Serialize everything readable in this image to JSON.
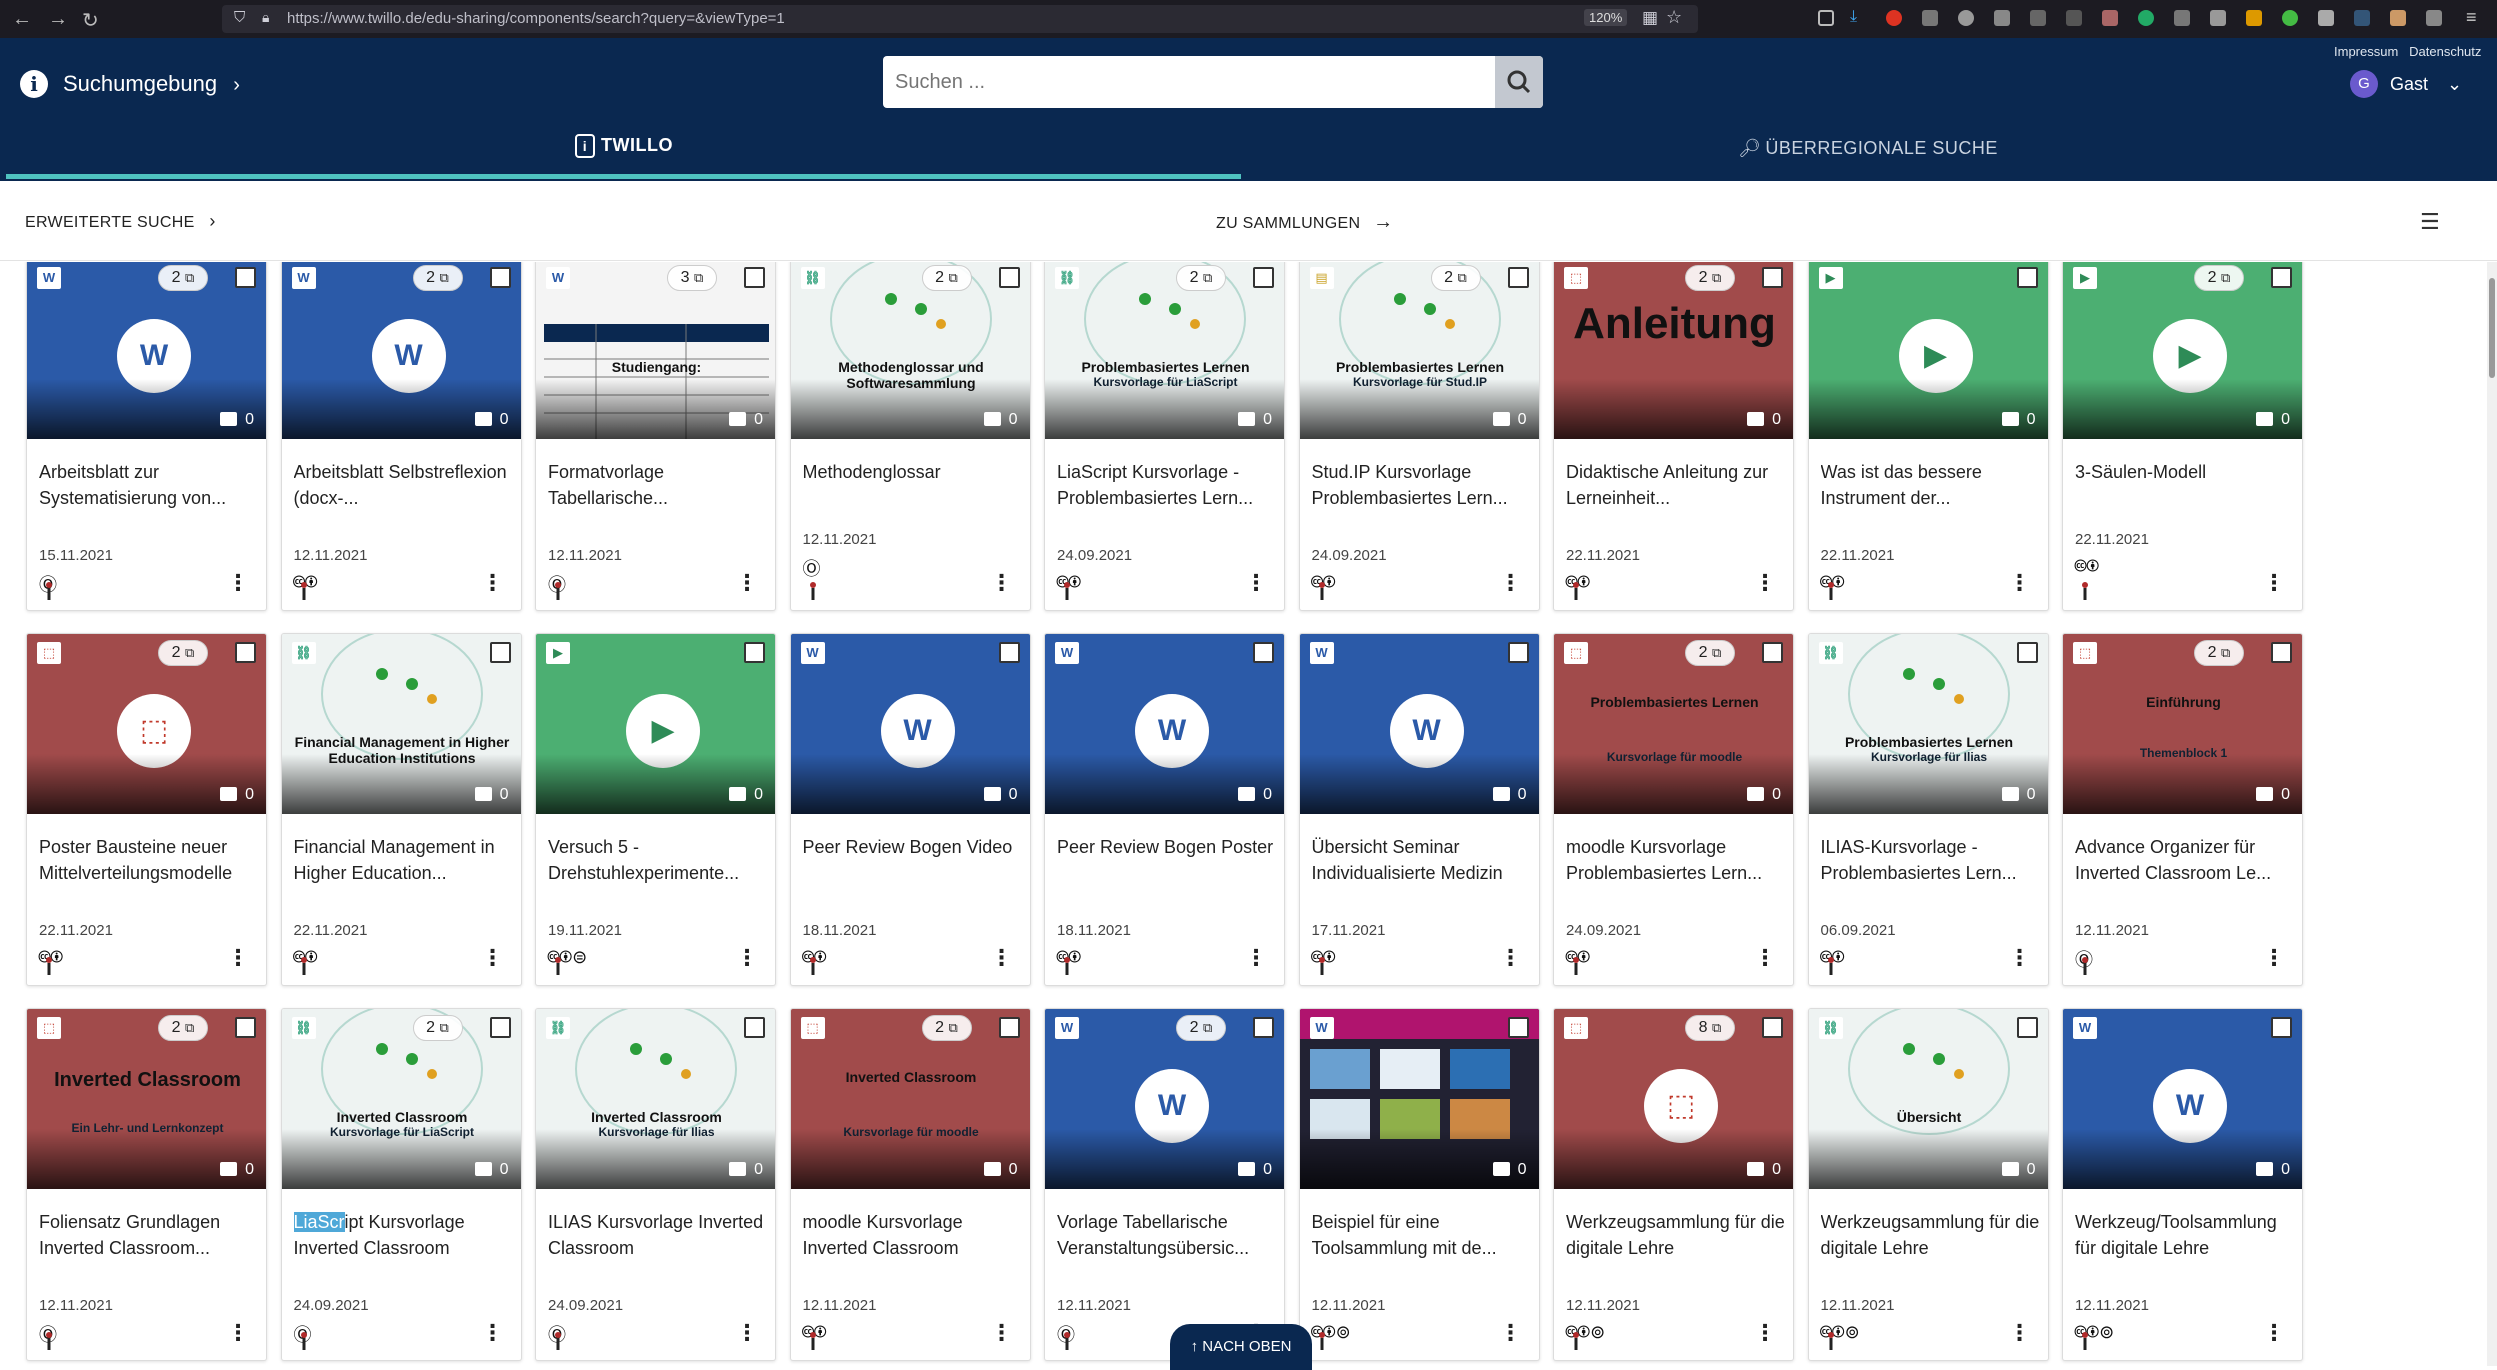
{
  "browser": {
    "url": "https://www.twillo.de/edu-sharing/components/search?query=&viewType=1",
    "zoom": "120%"
  },
  "header": {
    "brand": "Suchumgebung",
    "search_placeholder": "Suchen ...",
    "impressum": "Impressum",
    "datenschutz": "Datenschutz",
    "user_initial": "G",
    "user_name": "Gast",
    "tab_twillo": "TWILLO",
    "tab_overregional": "ÜBERREGIONALE SUCHE"
  },
  "subbar": {
    "advanced": "ERWEITERTE SUCHE",
    "collections": "ZU SAMMLUNGEN"
  },
  "back_to_top": "NACH OBEN",
  "colors": {
    "header": "#0a2850",
    "accent": "#4fc3c0"
  },
  "cards": [
    {
      "title": "Arbeitsblatt zur Systematisierung von...",
      "date": "15.11.2021",
      "license": "Ⓞ",
      "count": "2",
      "comments": "0",
      "type": "word-icon"
    },
    {
      "title": "Arbeitsblatt Selbstreflexion (docx-...",
      "date": "12.11.2021",
      "license": "🅭🅯",
      "count": "2",
      "comments": "0",
      "type": "word-icon"
    },
    {
      "title": "Formatvorlage Tabellarische...",
      "date": "12.11.2021",
      "license": "Ⓞ",
      "count": "3",
      "comments": "0",
      "type": "table",
      "thumb_text": "Studiengang:"
    },
    {
      "title": "Methodenglossar",
      "date": "12.11.2021",
      "license": "Ⓞ",
      "count": "2",
      "comments": "0",
      "type": "link-icon",
      "thumb_text": "Methodenglossar und Softwaresammlung"
    },
    {
      "title": "LiaScript Kursvorlage - Problembasiertes Lern...",
      "date": "24.09.2021",
      "license": "🅭🅯",
      "count": "2",
      "comments": "0",
      "type": "link-icon",
      "thumb_text": "Problembasiertes Lernen",
      "thumb_text2": "Kursvorlage für LiaScript"
    },
    {
      "title": "Stud.IP Kursvorlage Problembasiertes Lern...",
      "date": "24.09.2021",
      "license": "🅭🅯",
      "count": "2",
      "comments": "0",
      "type": "doc-icon",
      "thumb_text": "Problembasiertes Lernen",
      "thumb_text2": "Kursvorlage für Stud.IP"
    },
    {
      "title": "Didaktische Anleitung zur Lerneinheit...",
      "date": "22.11.2021",
      "license": "🅭🅯",
      "count": "2",
      "comments": "0",
      "type": "pdf-icon",
      "thumb_text": "Anleitung"
    },
    {
      "title": "Was ist das bessere Instrument der...",
      "date": "22.11.2021",
      "license": "🅭🅯",
      "count": "",
      "comments": "0",
      "type": "video-icon"
    },
    {
      "title": "3-Säulen-Modell",
      "date": "22.11.2021",
      "license": "🅭🅯",
      "count": "2",
      "comments": "0",
      "type": "video-icon"
    },
    {
      "title": "Poster Bausteine neuer Mittelverteilungsmodelle",
      "date": "22.11.2021",
      "license": "🅭🅯",
      "count": "2",
      "comments": "0",
      "type": "pdf-icon"
    },
    {
      "title": "Financial Management in Higher Education...",
      "date": "22.11.2021",
      "license": "🅭🅯",
      "count": "",
      "comments": "0",
      "type": "link-icon",
      "thumb_text": "Financial Management in Higher Education Institutions"
    },
    {
      "title": "Versuch 5 - Drehstuhlexperimente...",
      "date": "19.11.2021",
      "license": "🅭🅯⊜",
      "count": "",
      "comments": "0",
      "type": "video-icon"
    },
    {
      "title": "Peer Review Bogen Video",
      "date": "18.11.2021",
      "license": "🅭🅯",
      "count": "",
      "comments": "0",
      "type": "word-icon"
    },
    {
      "title": "Peer Review Bogen Poster",
      "date": "18.11.2021",
      "license": "🅭🅯",
      "count": "",
      "comments": "0",
      "type": "word-icon"
    },
    {
      "title": "Übersicht Seminar Individualisierte Medizin",
      "date": "17.11.2021",
      "license": "🅭🅯",
      "count": "",
      "comments": "0",
      "type": "word-icon"
    },
    {
      "title": "moodle Kursvorlage Problembasiertes Lern...",
      "date": "24.09.2021",
      "license": "🅭🅯",
      "count": "2",
      "comments": "0",
      "type": "pdf-icon",
      "thumb_text": "Problembasiertes Lernen",
      "thumb_text2": "Kursvorlage für moodle"
    },
    {
      "title": "ILIAS-Kursvorlage - Problembasiertes Lern...",
      "date": "06.09.2021",
      "license": "🅭🅯",
      "count": "",
      "comments": "0",
      "type": "link-icon",
      "thumb_text": "Problembasiertes Lernen",
      "thumb_text2": "Kursvorlage für Ilias"
    },
    {
      "title": "Advance Organizer für Inverted Classroom Le...",
      "date": "12.11.2021",
      "license": "Ⓞ",
      "count": "2",
      "comments": "0",
      "type": "pdf-icon",
      "thumb_text": "Einführung",
      "thumb_text2": "Themenblock 1"
    },
    {
      "title": "Foliensatz Grundlagen Inverted Classroom...",
      "date": "12.11.2021",
      "license": "Ⓞ",
      "count": "2",
      "comments": "0",
      "type": "pdf-icon",
      "thumb_text": "Inverted Classroom",
      "thumb_text2": "Ein Lehr- und Lernkonzept"
    },
    {
      "title_hl": "LiaScr",
      "title": "ipt Kursvorlage Inverted Classroom",
      "date": "24.09.2021",
      "license": "Ⓞ",
      "count": "2",
      "comments": "0",
      "type": "link-icon",
      "thumb_text": "Inverted Classroom",
      "thumb_text2": "Kursvorlage für LiaScript"
    },
    {
      "title": "ILIAS Kursvorlage Inverted Classroom",
      "date": "24.09.2021",
      "license": "Ⓞ",
      "count": "",
      "comments": "0",
      "type": "link-icon",
      "thumb_text": "Inverted Classroom",
      "thumb_text2": "Kursvorlage für Ilias"
    },
    {
      "title": "moodle Kursvorlage Inverted Classroom",
      "date": "12.11.2021",
      "license": "🅭🅯",
      "count": "2",
      "comments": "0",
      "type": "pdf-icon",
      "thumb_text": "Inverted Classroom",
      "thumb_text2": "Kursvorlage für moodle"
    },
    {
      "title": "Vorlage Tabellarische Veranstaltungsübersic...",
      "date": "12.11.2021",
      "license": "Ⓞ",
      "count": "2",
      "comments": "0",
      "type": "word-icon"
    },
    {
      "title": "Beispiel für eine Toolsammlung mit de...",
      "date": "12.11.2021",
      "license": "🅭🅯⊚",
      "count": "",
      "comments": "0",
      "type": "screens"
    },
    {
      "title": "Werkzeugsammlung für die digitale Lehre",
      "date": "12.11.2021",
      "license": "🅭🅯⊚",
      "count": "8",
      "comments": "0",
      "type": "pdf-icon"
    },
    {
      "title": "Werkzeugsammlung für die digitale Lehre",
      "date": "12.11.2021",
      "license": "🅭🅯⊚",
      "count": "",
      "comments": "0",
      "type": "link-icon",
      "thumb_text": "Übersicht"
    },
    {
      "title": "Werkzeug/Toolsammlung für digitale Lehre",
      "date": "12.11.2021",
      "license": "🅭🅯⊚",
      "count": "",
      "comments": "0",
      "type": "word-icon"
    }
  ]
}
